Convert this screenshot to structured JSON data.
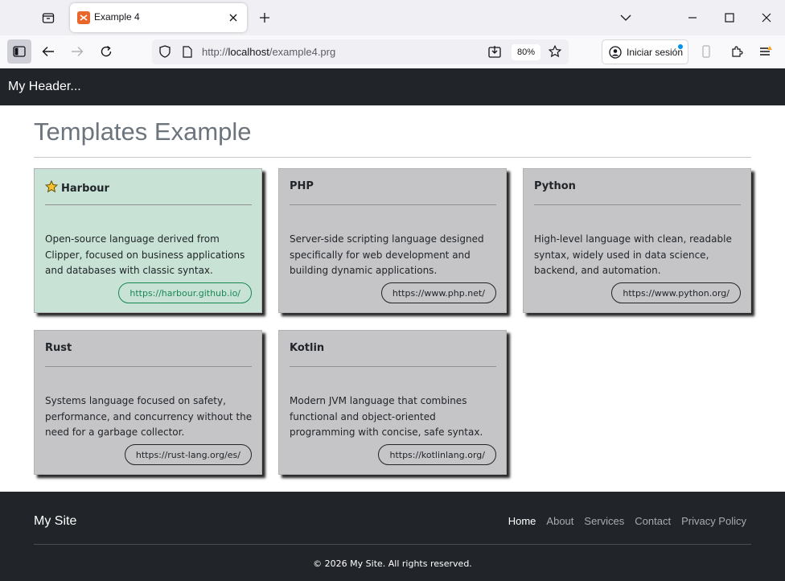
{
  "browser": {
    "tab_title": "Example 4",
    "url_prefix": "http://",
    "url_host": "localhost",
    "url_path": "/example4.prg",
    "zoom": "80%",
    "signin_label": "Iniciar sesión"
  },
  "site": {
    "header_title": "My Header...",
    "page_title": "Templates Example"
  },
  "cards": [
    {
      "title": "Harbour",
      "icon": "star-icon",
      "description": "Open-source language derived from Clipper, focused on business applications and databases with classic syntax.",
      "link": "https://harbour.github.io/",
      "highlight": true
    },
    {
      "title": "PHP",
      "description": "Server-side scripting language designed specifically for web development and building dynamic applications.",
      "link": "https://www.php.net/"
    },
    {
      "title": "Python",
      "description": "High-level language with clean, readable syntax, widely used in data science, backend, and automation.",
      "link": "https://www.python.org/"
    },
    {
      "title": "Rust",
      "description": "Systems language focused on safety, performance, and concurrency without the need for a garbage collector.",
      "link": "https://rust-lang.org/es/"
    },
    {
      "title": "Kotlin",
      "description": "Modern JVM language that combines functional and object-oriented programming with concise, safe syntax.",
      "link": "https://kotlinlang.org/"
    }
  ],
  "footer": {
    "brand": "My Site",
    "nav": [
      "Home",
      "About",
      "Services",
      "Contact",
      "Privacy Policy"
    ],
    "copyright": "© 2026 My Site. All rights reserved."
  },
  "colors": {
    "header_bg": "#212529",
    "card_bg": "#c5c5c8",
    "card_highlight_bg": "#c8e3d5",
    "link_highlight": "#198754"
  }
}
